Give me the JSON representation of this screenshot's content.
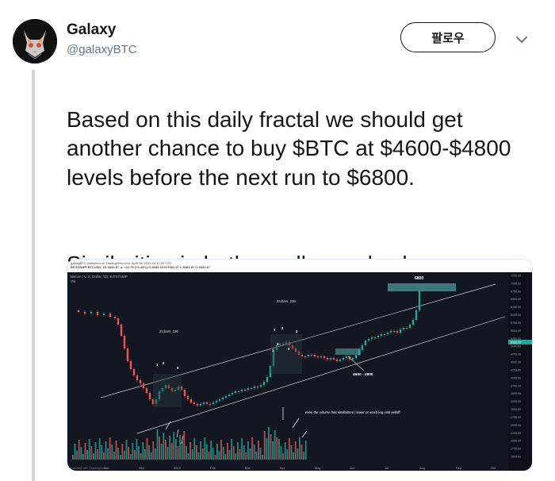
{
  "author": {
    "name": "Galaxy",
    "handle": "@galaxyBTC"
  },
  "follow_label": "팔로우",
  "tweet": {
    "line1": "Based on this daily fractal we should get another chance to buy $BTC at $4600-$4800 levels before the next run to $6800.",
    "line2": "Similarities in both candles and volume."
  },
  "media": {
    "publisher_line": "galaxyBTC published on TradingView.com, April 28, 2019 16:12:31 UTC",
    "symbol_line": "BITSTAMP:BTCUSD, 1D 5332.87 ▲ +22.75 (+0.43%) O:5289.03 H:5362.97 L:5263.87 C:5332.87",
    "title_line": "Bitcoin / U.S. Dollar, 1D, BITSTAMP",
    "vol_label": "Vol",
    "footer": "Created with TradingView",
    "annotations": {
      "bars_a": "23 bars, 230",
      "bars_b": "23 bars, 230",
      "target": "6800",
      "zone": "4600 - 4800",
      "volume_note": "even the volume has similarities / lower on each leg until selloff"
    },
    "x_ticks": [
      "Nov",
      "Dec",
      "2019",
      "Feb",
      "Mar",
      "Apr",
      "May",
      "Jun",
      "Jul",
      "Aug",
      "Sep",
      "Oct"
    ],
    "y_ticks": [
      "7250.00",
      "7000.00",
      "6750.00",
      "6500.00",
      "6250.00",
      "6000.00",
      "5750.00",
      "5500.00",
      "5250.00",
      "5000.00",
      "4750.00",
      "4500.00",
      "4250.00",
      "4000.00",
      "3750.00",
      "3500.00",
      "3250.00",
      "3000.00",
      "2750.00",
      "2500.00",
      "2250.00",
      "2000.00",
      "1750.00",
      "1500.00"
    ],
    "price_tag": "5332.87",
    "wave_labels": [
      "1",
      "2",
      "3",
      "1",
      "2",
      "3",
      "1",
      "2",
      "3"
    ],
    "colors": {
      "background": "#131722",
      "bull": "#26a69a",
      "bear": "#ef5350",
      "target_box": "#4fa3a5",
      "zone_box": "#4fa3a5"
    }
  }
}
